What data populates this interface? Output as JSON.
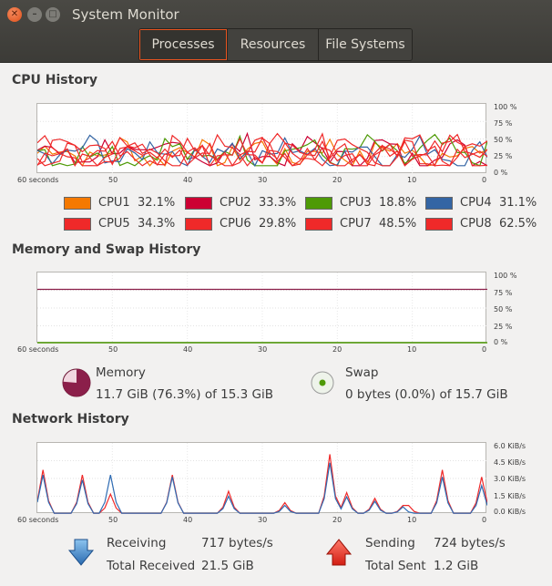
{
  "window": {
    "title": "System Monitor"
  },
  "tabs": [
    {
      "label": "Processes",
      "active": true
    },
    {
      "label": "Resources",
      "active": false
    },
    {
      "label": "File Systems",
      "active": false
    }
  ],
  "cpu": {
    "title": "CPU History",
    "y_labels": [
      "100 %",
      "75 %",
      "50 %",
      "25 %",
      "0 %"
    ],
    "x_labels": [
      "60 seconds",
      "50",
      "40",
      "30",
      "20",
      "10",
      "0"
    ],
    "cores": [
      {
        "name": "CPU1",
        "value": "32.1%",
        "color": "#f57900"
      },
      {
        "name": "CPU2",
        "value": "33.3%",
        "color": "#cc0033"
      },
      {
        "name": "CPU3",
        "value": "18.8%",
        "color": "#4e9a06"
      },
      {
        "name": "CPU4",
        "value": "31.1%",
        "color": "#3465a4"
      },
      {
        "name": "CPU5",
        "value": "34.3%",
        "color": "#ef2929"
      },
      {
        "name": "CPU6",
        "value": "29.8%",
        "color": "#ef2929"
      },
      {
        "name": "CPU7",
        "value": "48.5%",
        "color": "#ef2929"
      },
      {
        "name": "CPU8",
        "value": "62.5%",
        "color": "#ef2929"
      }
    ]
  },
  "memory": {
    "title": "Memory and Swap History",
    "y_labels": [
      "100 %",
      "75 %",
      "50 %",
      "25 %",
      "0 %"
    ],
    "x_labels": [
      "60 seconds",
      "50",
      "40",
      "30",
      "20",
      "10",
      "0"
    ],
    "mem_label": "Memory",
    "mem_value": "11.7 GiB (76.3%) of 15.3 GiB",
    "mem_percent": 76.3,
    "mem_color": "#8b1f4a",
    "swap_label": "Swap",
    "swap_value": "0 bytes (0.0%) of 15.7 GiB",
    "swap_percent": 0,
    "swap_color": "#4e9a06"
  },
  "network": {
    "title": "Network History",
    "y_labels": [
      "6.0 KiB/s",
      "4.5 KiB/s",
      "3.0 KiB/s",
      "1.5 KiB/s",
      "0.0 KiB/s"
    ],
    "x_labels": [
      "60 seconds",
      "50",
      "40",
      "30",
      "20",
      "10",
      "0"
    ],
    "receiving_label": "Receiving",
    "receiving_value": "717 bytes/s",
    "total_received_label": "Total Received",
    "total_received_value": "21.5 GiB",
    "sending_label": "Sending",
    "sending_value": "724 bytes/s",
    "total_sent_label": "Total Sent",
    "total_sent_value": "1.2 GiB",
    "receive_color": "#2e6bb3",
    "send_color": "#ef2929"
  }
}
